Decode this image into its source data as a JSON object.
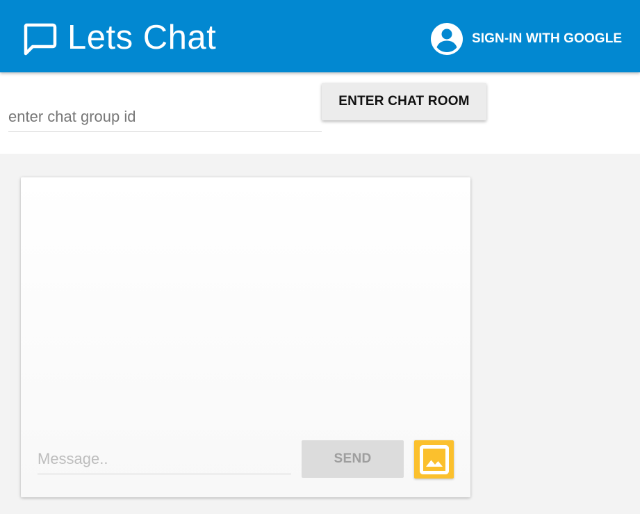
{
  "header": {
    "title": "Lets Chat",
    "logo_icon": "chat-bubble-icon",
    "signin_label": "SIGN-IN WITH GOOGLE",
    "signin_icon": "account-circle-icon"
  },
  "group": {
    "input_placeholder": "enter chat group id",
    "input_value": "",
    "enter_button_label": "ENTER CHAT ROOM"
  },
  "chat": {
    "message_placeholder": "Message..",
    "message_value": "",
    "send_button_label": "SEND",
    "send_enabled": false,
    "image_button_icon": "image-icon"
  },
  "colors": {
    "header": "#0288d1",
    "image_button": "#fbc02d",
    "background": "#f3f3f3",
    "send_disabled": "#dcdcdc"
  }
}
